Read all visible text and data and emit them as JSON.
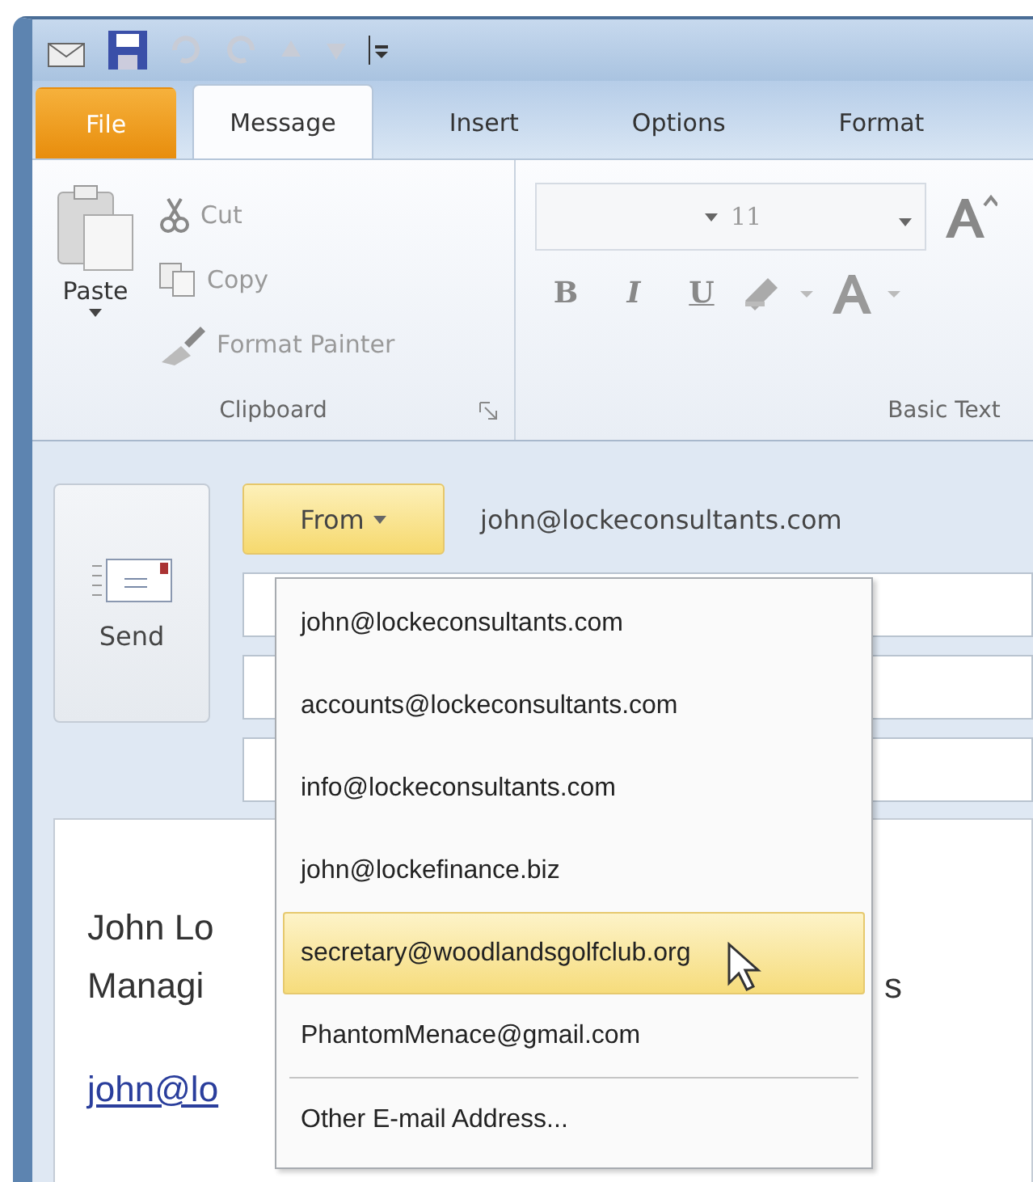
{
  "tabs": [
    {
      "label": "File",
      "kind": "file",
      "selected": false
    },
    {
      "label": "Message",
      "kind": "tab",
      "selected": true
    },
    {
      "label": "Insert",
      "kind": "tab",
      "selected": false
    },
    {
      "label": "Options",
      "kind": "tab",
      "selected": false
    },
    {
      "label": "Format",
      "kind": "tab",
      "selected": false
    }
  ],
  "clipboard": {
    "paste": "Paste",
    "cut": "Cut",
    "copy": "Copy",
    "format_painter": "Format Painter",
    "label": "Clipboard"
  },
  "basic_text": {
    "font_size": "11",
    "bold": "B",
    "italic": "I",
    "underline": "U",
    "label": "Basic Text"
  },
  "send": "Send",
  "from": {
    "label": "From",
    "address": "john@lockeconsultants.com"
  },
  "from_menu": {
    "items": [
      {
        "label": "john@lockeconsultants.com",
        "selected": false
      },
      {
        "label": "accounts@lockeconsultants.com",
        "selected": false
      },
      {
        "label": "info@lockeconsultants.com",
        "selected": false
      },
      {
        "label": "john@lockefinance.biz",
        "selected": false
      },
      {
        "label": "secretary@woodlandsgolfclub.org",
        "selected": true
      },
      {
        "label": "PhantomMenace@gmail.com",
        "selected": false
      }
    ],
    "other": "Other E-mail Address..."
  },
  "body": {
    "lines": [
      "John Lo",
      "Managi"
    ],
    "trailing": "s",
    "link": "john@lo"
  }
}
